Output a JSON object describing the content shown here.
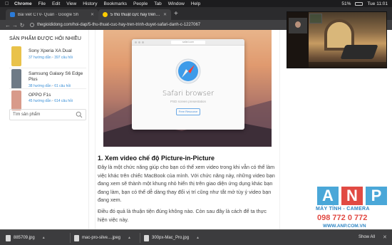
{
  "menubar": {
    "app": "Chrome",
    "items": [
      "File",
      "Edit",
      "View",
      "History",
      "Bookmarks",
      "People",
      "Tab",
      "Window",
      "Help"
    ],
    "battery": "51%",
    "time": "Tue 11:01"
  },
  "tabs": [
    {
      "label": "Bài viết CTV- Quản · Google Sh"
    },
    {
      "label": "5 thủ thuật cực hay trên trình"
    }
  ],
  "toolbar": {
    "url": "thegioididong.com/hoi-dap/5-thu-thuat-cuc-hay-tren-trinh-duyet-safari-danh-c-1227067"
  },
  "sidebar": {
    "title": "SẢN PHẨM ĐƯỢC HỎI NHIỀU",
    "products": [
      {
        "name": "Sony Xperia XA Dual",
        "questions": "37 hướng dẫn",
        "comments": "397 câu hỏi",
        "color": "#e9c24a"
      },
      {
        "name": "Samsung Galaxy S6 Edge Plus",
        "questions": "38 hướng dẫn",
        "comments": "61 câu hỏi",
        "color": "#6e7a86"
      },
      {
        "name": "OPPO F1s",
        "questions": "45 hướng dẫn",
        "comments": "614 câu hỏi",
        "color": "#d89a8a"
      }
    ],
    "search_placeholder": "Tìm sản phẩm"
  },
  "article": {
    "hero": {
      "url_text": "safari.com",
      "title": "Safari browser",
      "subtitle": "PSD screen presentation",
      "button": "Free Resource"
    },
    "heading": "1. Xem video chế độ Picture-in-Picture",
    "para1": "Đây là một chức năng giúp cho bạn có thể xem video trong khi vẫn có thể làm việc khác trên chiếc MacBook của mình. Với chức năng này, những video bạn đang xem sẽ thành một khung nhỏ hiển thị trên giao diện ứng dụng khác bạn đang làm, bạn có thể dễ dàng thay đổi vị trí cũng như tắt mở tùy ý video bạn đang xem.",
    "para2": "Điều đó quả là thuận tiện đúng không nào. Còn sau đây là cách để ta thực hiện việc này."
  },
  "logo": {
    "letters": [
      "A",
      "N",
      "P"
    ],
    "line1": "MÁY TÍNH - CAMERA",
    "line2": "098 772 0 772",
    "line3": "WWW.ANP.COM.VN"
  },
  "downloads": {
    "items": [
      "885709.jpg",
      "mac-pro-silve....jpeg",
      "300px-Mac_Pro.jpg"
    ],
    "show_all": "Show All"
  }
}
